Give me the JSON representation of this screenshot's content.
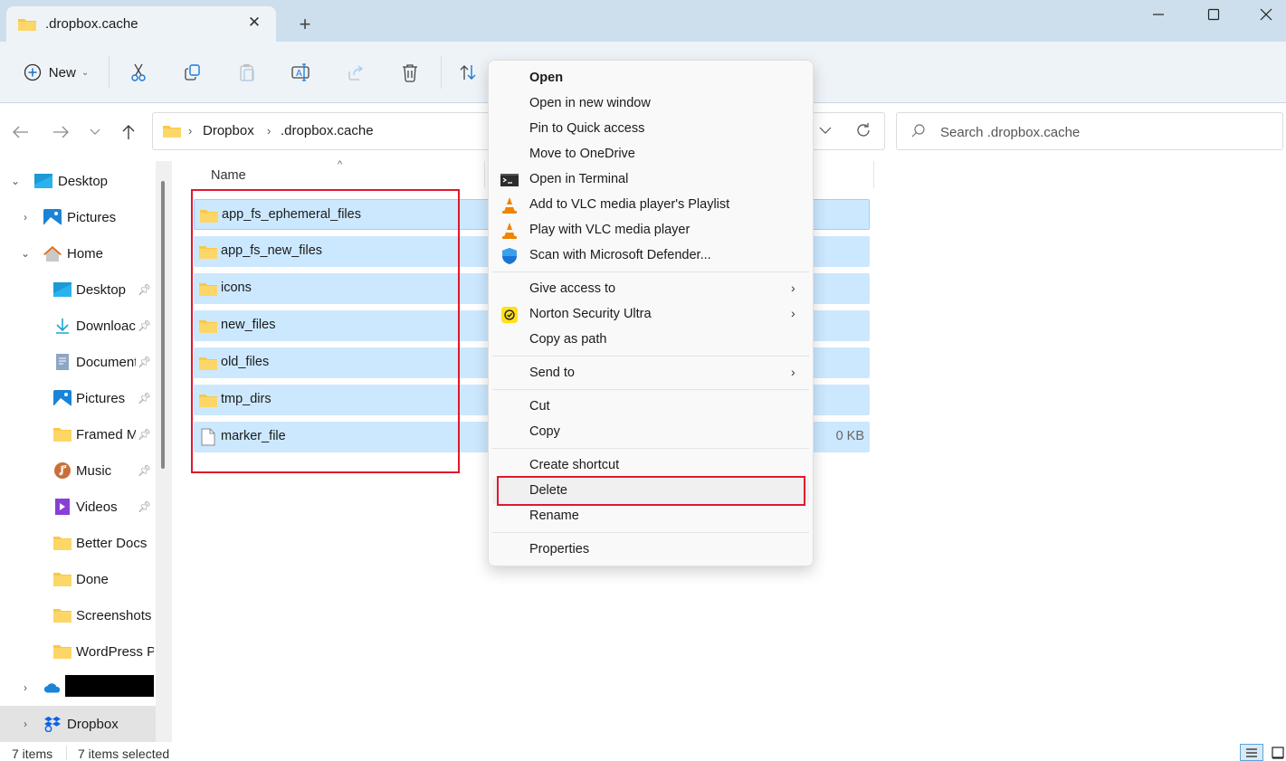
{
  "window": {
    "tab_title": ".dropbox.cache",
    "tab_close_icon": "close-icon",
    "new_tab_icon": "plus-icon",
    "controls": [
      "minimize-icon",
      "maximize-icon",
      "close-icon"
    ]
  },
  "toolbar": {
    "new_label": "New",
    "buttons": [
      "cut",
      "copy",
      "paste",
      "rename",
      "share",
      "delete",
      "sort"
    ]
  },
  "address": {
    "crumbs": [
      "Dropbox",
      ".dropbox.cache"
    ],
    "search_placeholder": "Search .dropbox.cache"
  },
  "sidebar": {
    "items": [
      {
        "label": "Desktop",
        "icon": "desktop-icon",
        "expanded": true
      },
      {
        "label": "Pictures",
        "icon": "pictures-icon",
        "expanded": false
      },
      {
        "label": "Home",
        "icon": "home-icon",
        "expanded": true
      },
      {
        "label": "Desktop",
        "icon": "desktop-icon",
        "pinned": true
      },
      {
        "label": "Downloac",
        "icon": "downloads-icon",
        "pinned": true
      },
      {
        "label": "Document",
        "icon": "documents-icon",
        "pinned": true
      },
      {
        "label": "Pictures",
        "icon": "pictures-icon",
        "pinned": true
      },
      {
        "label": "Framed M",
        "icon": "folder-icon",
        "pinned": true
      },
      {
        "label": "Music",
        "icon": "music-icon",
        "pinned": true
      },
      {
        "label": "Videos",
        "icon": "videos-icon",
        "pinned": true
      },
      {
        "label": "Better Docs",
        "icon": "folder-icon"
      },
      {
        "label": "Done",
        "icon": "folder-icon"
      },
      {
        "label": "Screenshots",
        "icon": "folder-icon"
      },
      {
        "label": "WordPress Pi",
        "icon": "folder-icon"
      },
      {
        "label": "",
        "icon": "onedrive-icon",
        "redacted": true
      },
      {
        "label": "Dropbox",
        "icon": "dropbox-icon",
        "active": true
      }
    ]
  },
  "files": {
    "column_name": "Name",
    "rows": [
      {
        "name": "app_fs_ephemeral_files",
        "type": "folder",
        "size": ""
      },
      {
        "name": "app_fs_new_files",
        "type": "folder",
        "size": ""
      },
      {
        "name": "icons",
        "type": "folder",
        "size": ""
      },
      {
        "name": "new_files",
        "type": "folder",
        "size": ""
      },
      {
        "name": "old_files",
        "type": "folder",
        "size": ""
      },
      {
        "name": "tmp_dirs",
        "type": "folder",
        "size": ""
      },
      {
        "name": "marker_file",
        "type": "file",
        "size": "0 KB"
      }
    ]
  },
  "context_menu": {
    "items": [
      {
        "label": "Open",
        "bold": true
      },
      {
        "label": "Open in new window"
      },
      {
        "label": "Pin to Quick access"
      },
      {
        "label": "Move to OneDrive"
      },
      {
        "label": "Open in Terminal",
        "icon": "terminal-icon"
      },
      {
        "label": "Add to VLC media player's Playlist",
        "icon": "vlc-icon"
      },
      {
        "label": "Play with VLC media player",
        "icon": "vlc-icon"
      },
      {
        "label": "Scan with Microsoft Defender...",
        "icon": "defender-shield-icon"
      },
      {
        "label": "Give access to",
        "submenu": true
      },
      {
        "label": "Norton Security Ultra",
        "icon": "norton-icon",
        "submenu": true
      },
      {
        "label": "Copy as path"
      },
      {
        "label": "Send to",
        "submenu": true
      },
      {
        "label": "Cut"
      },
      {
        "label": "Copy"
      },
      {
        "label": "Create shortcut"
      },
      {
        "label": "Delete",
        "highlighted": true
      },
      {
        "label": "Rename"
      },
      {
        "label": "Properties"
      }
    ]
  },
  "status": {
    "item_count": "7 items",
    "selected_count": "7 items selected"
  },
  "colors": {
    "selection": "#cce8ff",
    "highlight_box": "#e0182d",
    "titlebar": "#cddfec",
    "toolbar": "#eef3f8"
  }
}
